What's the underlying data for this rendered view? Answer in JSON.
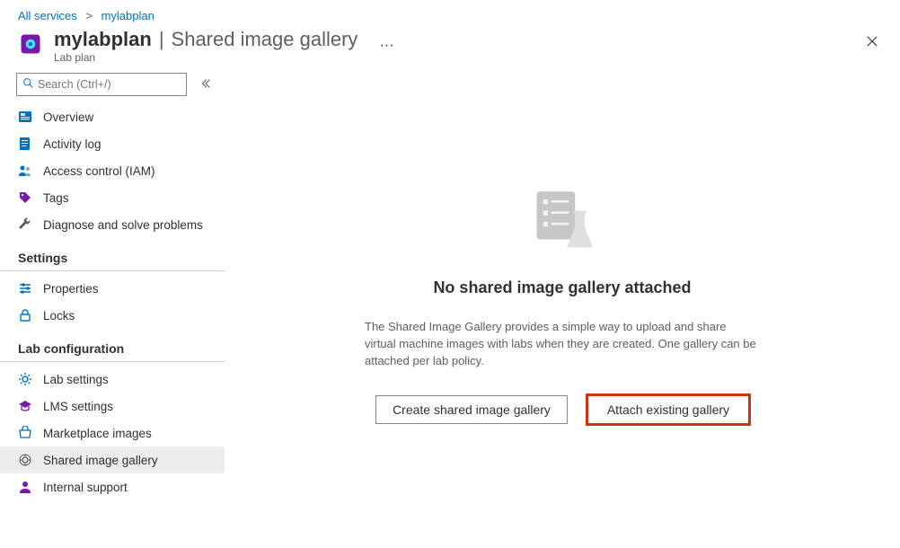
{
  "breadcrumb": {
    "root": "All services",
    "current": "mylabplan"
  },
  "header": {
    "name": "mylabplan",
    "separator": "|",
    "sub": "Shared image gallery",
    "type": "Lab plan"
  },
  "search": {
    "placeholder": "Search (Ctrl+/)"
  },
  "sidebar": {
    "items": [
      {
        "label": "Overview",
        "icon": "overview-icon",
        "color": "#0072C6"
      },
      {
        "label": "Activity log",
        "icon": "log-icon",
        "color": "#0072C6"
      },
      {
        "label": "Access control (IAM)",
        "icon": "people-icon",
        "color": "#0072C6"
      },
      {
        "label": "Tags",
        "icon": "tag-icon",
        "color": "#7719aa"
      },
      {
        "label": "Diagnose and solve problems",
        "icon": "wrench-icon",
        "color": "#323130"
      }
    ],
    "group_settings": "Settings",
    "settings": [
      {
        "label": "Properties",
        "icon": "sliders-icon",
        "color": "#0072C6"
      },
      {
        "label": "Locks",
        "icon": "lock-icon",
        "color": "#0072C6"
      }
    ],
    "group_lab": "Lab configuration",
    "lab": [
      {
        "label": "Lab settings",
        "icon": "gear-icon",
        "color": "#0072C6"
      },
      {
        "label": "LMS settings",
        "icon": "grad-icon",
        "color": "#7719aa"
      },
      {
        "label": "Marketplace images",
        "icon": "market-icon",
        "color": "#0072C6"
      },
      {
        "label": "Shared image gallery",
        "icon": "share-gear-icon",
        "color": "#605e5c",
        "selected": true
      },
      {
        "label": "Internal support",
        "icon": "person-icon",
        "color": "#7719aa"
      }
    ]
  },
  "empty": {
    "title": "No shared image gallery attached",
    "desc": "The Shared Image Gallery provides a simple way to upload and share virtual machine images with labs when they are created. One gallery can be attached per lab policy.",
    "btn_create": "Create shared image gallery",
    "btn_attach": "Attach existing gallery"
  }
}
